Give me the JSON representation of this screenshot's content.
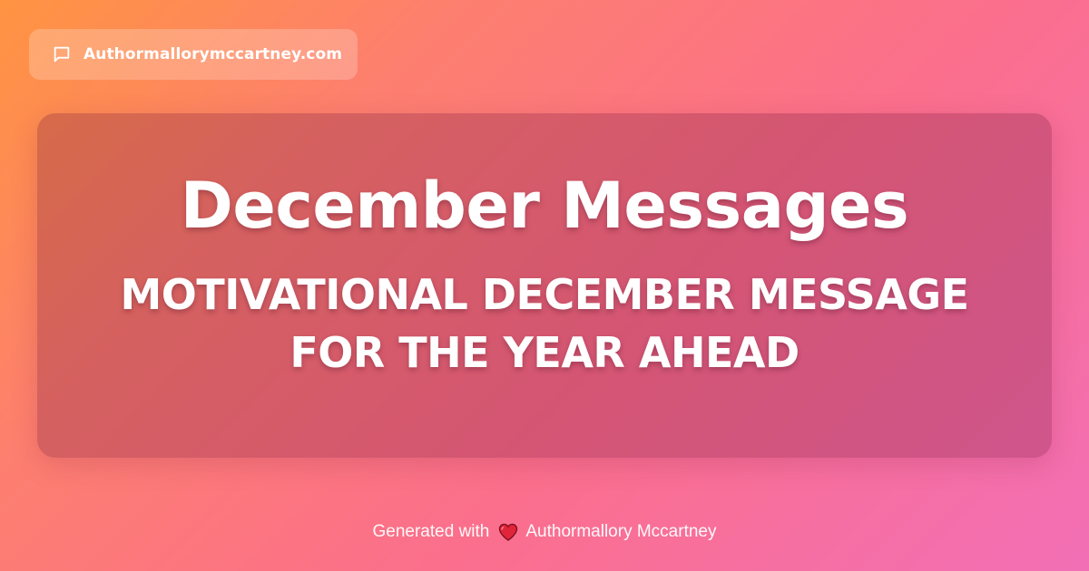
{
  "site_badge": {
    "icon": "chat-bubble-icon",
    "label": "Authormallorymccartney.com"
  },
  "card": {
    "title": "December Messages",
    "subtitle": "MOTIVATIONAL DECEMBER MESSAGE FOR THE YEAR AHEAD"
  },
  "footer": {
    "prefix": "Generated with",
    "icon": "heart-icon",
    "author": "Authormallory Mccartney"
  },
  "colors": {
    "gradient_start": "#ff9441",
    "gradient_end": "#f26fb6",
    "heart": "#e0243a"
  }
}
